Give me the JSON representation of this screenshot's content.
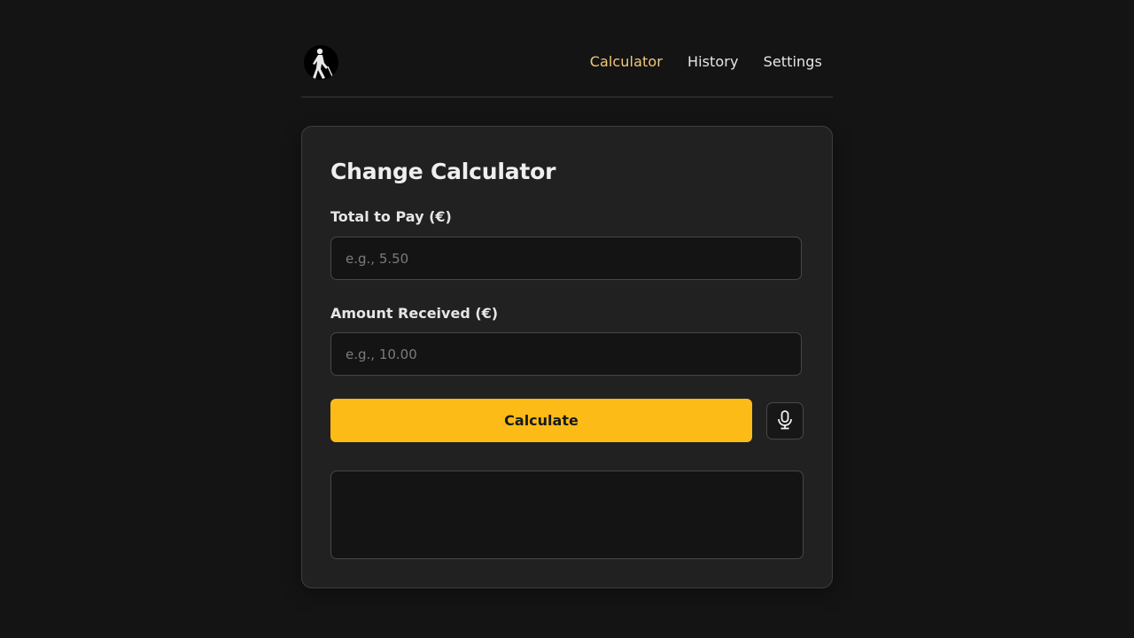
{
  "header": {
    "logo_icon": "walking-person-with-cane-icon",
    "nav": [
      {
        "label": "Calculator",
        "active": true
      },
      {
        "label": "History",
        "active": false
      },
      {
        "label": "Settings",
        "active": false
      }
    ]
  },
  "card": {
    "title": "Change Calculator",
    "total_field": {
      "label": "Total to Pay (€)",
      "placeholder": "e.g., 5.50",
      "value": ""
    },
    "received_field": {
      "label": "Amount Received (€)",
      "placeholder": "e.g., 10.00",
      "value": ""
    },
    "calculate_label": "Calculate",
    "mic_icon": "microphone-icon",
    "result": ""
  },
  "colors": {
    "background": "#141414",
    "card": "#212121",
    "accent": "#fdbb17",
    "nav_active": "#f3c77a"
  }
}
